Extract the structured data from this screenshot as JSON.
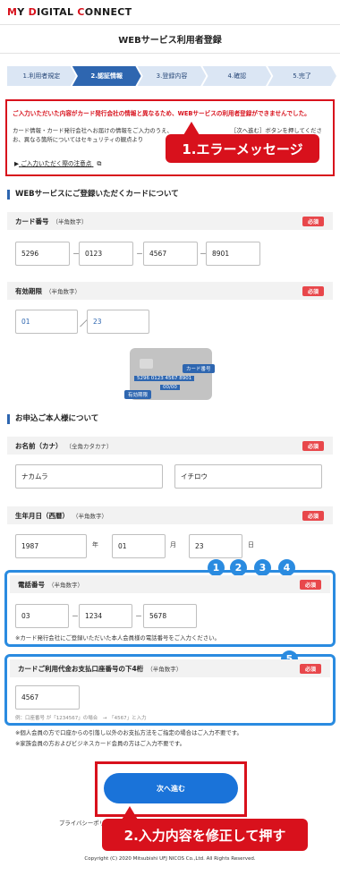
{
  "header": {
    "logo_my": "M",
    "logo_y": "Y ",
    "logo_d": "D",
    "logo_igital": "IGITAL ",
    "logo_c": "C",
    "logo_onnect": "ONNECT"
  },
  "page": {
    "title": "WEBサービス利用者登録"
  },
  "steps": [
    "1.利用者規定",
    "2.認証情報",
    "3.登録内容",
    "4.確認",
    "5.完了"
  ],
  "error": {
    "message": "ご入力いただいた内容がカード発行会社の情報と異なるため、WEBサービスの利用者登録ができませんでした。",
    "desc_left": "カード情報・カード発行会社へお届けの情報をご入力のうえ、\nお、異なる箇所についてはセキュリティの観点より",
    "desc_right": "［次へ進む］ボタンを押してください。",
    "notice_link": "ご入力いただく際の注意点"
  },
  "callouts": {
    "error": "1.エラーメッセージ",
    "submit": "2.入力内容を修正して押す"
  },
  "card_section": {
    "title": "WEBサービスにご登録いただくカードについて",
    "card_number": {
      "label": "カード番号",
      "sub": "（半角数字）",
      "required": "必須",
      "values": [
        "5296",
        "0123",
        "4567",
        "8901"
      ]
    },
    "expiry": {
      "label": "有効期限",
      "sub": "（半角数字）",
      "required": "必須",
      "month": "01",
      "year": "23"
    },
    "card_image": {
      "number": "5296 0123 4567 8901",
      "expiry": "00/00",
      "tag_number": "カード番号",
      "tag_expiry": "有効期限"
    }
  },
  "person_section": {
    "title": "お申込ご本人様について",
    "name": {
      "label": "お名前（カナ）",
      "sub": "（全角カタカナ）",
      "required": "必須",
      "last": "ナカムラ",
      "first": "イチロウ"
    },
    "birth": {
      "label": "生年月日（西暦）",
      "sub": "（半角数字）",
      "required": "必須",
      "year": "1987",
      "year_unit": "年",
      "month": "01",
      "month_unit": "月",
      "day": "23",
      "day_unit": "日"
    },
    "phone": {
      "label": "電話番号",
      "sub": "（半角数字）",
      "required": "必須",
      "values": [
        "03",
        "1234",
        "5678"
      ],
      "note": "※カード発行会社にご登録いただいた本人会員様の電話番号をご入力ください。"
    },
    "account": {
      "label": "カードご利用代金お支払口座番号の下4桁",
      "sub": "（半角数字）",
      "required": "必須",
      "value": "4567",
      "hint": "例：口座番号 が「1234567」の場合　→　「4567」と入力"
    },
    "notes": [
      "※個人会員の方で口座からの引落し以外のお支払方法をご指定の場合はご入力不要です。",
      "※家族会員の方およびビジネスカード会員の方はご入力不要です。"
    ]
  },
  "badges": [
    "1",
    "2",
    "3",
    "4",
    "5"
  ],
  "buttons": {
    "next": "次へ進む"
  },
  "footer": {
    "privacy": "プライバシーポリシー",
    "copyright": "Copyright (C) 2020 Mitsubishi UFJ NICOS Co.,Ltd. All Rights Reserved."
  },
  "colors": {
    "accent_blue": "#2e66b0",
    "error_red": "#d8111c",
    "annotation_blue": "#2a8be0"
  },
  "icons": {
    "notice_arrow": "triangle-right-icon",
    "external_link": "external-link-icon"
  }
}
